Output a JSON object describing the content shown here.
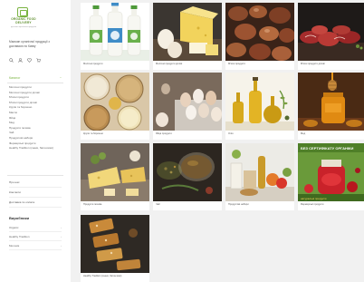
{
  "brand": {
    "logo_line1": "ORGANIC FOOD",
    "logo_line2": "DELIVERY",
    "logo_sub": "доставка органічних продуктів",
    "tagline": "Магазин органічної продукції з доставкою по Києву"
  },
  "toolbar_icons": [
    "search-icon",
    "user-icon",
    "heart-icon",
    "cart-icon"
  ],
  "nav": {
    "heading": "Каталог",
    "heading_toggle": "−",
    "items": [
      "Молочні продукти",
      "Молочні продукти ділові",
      "М'ясні продукти",
      "М'ясні продукти ділові",
      "Крупи та борошно",
      "Масло",
      "Яйця",
      "Мед",
      "Продукти печива",
      "Чай",
      "Продуктові набори",
      "Фермерські продукти",
      "Healthy Tradition (снеки, батончики)"
    ]
  },
  "links": [
    "Про нас",
    "Контакти",
    "Доставка та оплата"
  ],
  "filters": {
    "title": "Виробники",
    "items": [
      {
        "label": "Organic",
        "arrow": "›"
      },
      {
        "label": "Healthy Tradition",
        "arrow": "›"
      },
      {
        "label": "Молокія",
        "arrow": "›"
      }
    ]
  },
  "tiles": [
    {
      "caption": "Молочні продукти",
      "image": "milk-bottles"
    },
    {
      "caption": "Молочні продукти ділові",
      "image": "cheese-eggs"
    },
    {
      "caption": "М'ясні продукти",
      "image": "sausages"
    },
    {
      "caption": "М'ясні продукти ділові",
      "image": "raw-meat"
    },
    {
      "caption": "Крупи та борошно",
      "image": "grains"
    },
    {
      "caption": "Яйця продукти",
      "image": "eggs"
    },
    {
      "caption": "Олія",
      "image": "oil-bottles"
    },
    {
      "caption": "Мед",
      "image": "honey"
    },
    {
      "caption": "Продукти печива",
      "image": "cheese-board"
    },
    {
      "caption": "Чай",
      "image": "tea"
    },
    {
      "caption": "Продуктові набори",
      "image": "grocery-set"
    },
    {
      "caption": "Фермерські продукти",
      "image": "organic-banner",
      "banner_text": "БЕЗ СЕРТИФІКАТУ ОРГАНІКИ",
      "banner_sub": "натуральні продукти"
    },
    {
      "caption": "Healthy Tradition (снеки, батончики)",
      "image": "granola-bars"
    }
  ],
  "colors": {
    "accent": "#7ab441",
    "grid_bg": "#f1f1f1"
  }
}
